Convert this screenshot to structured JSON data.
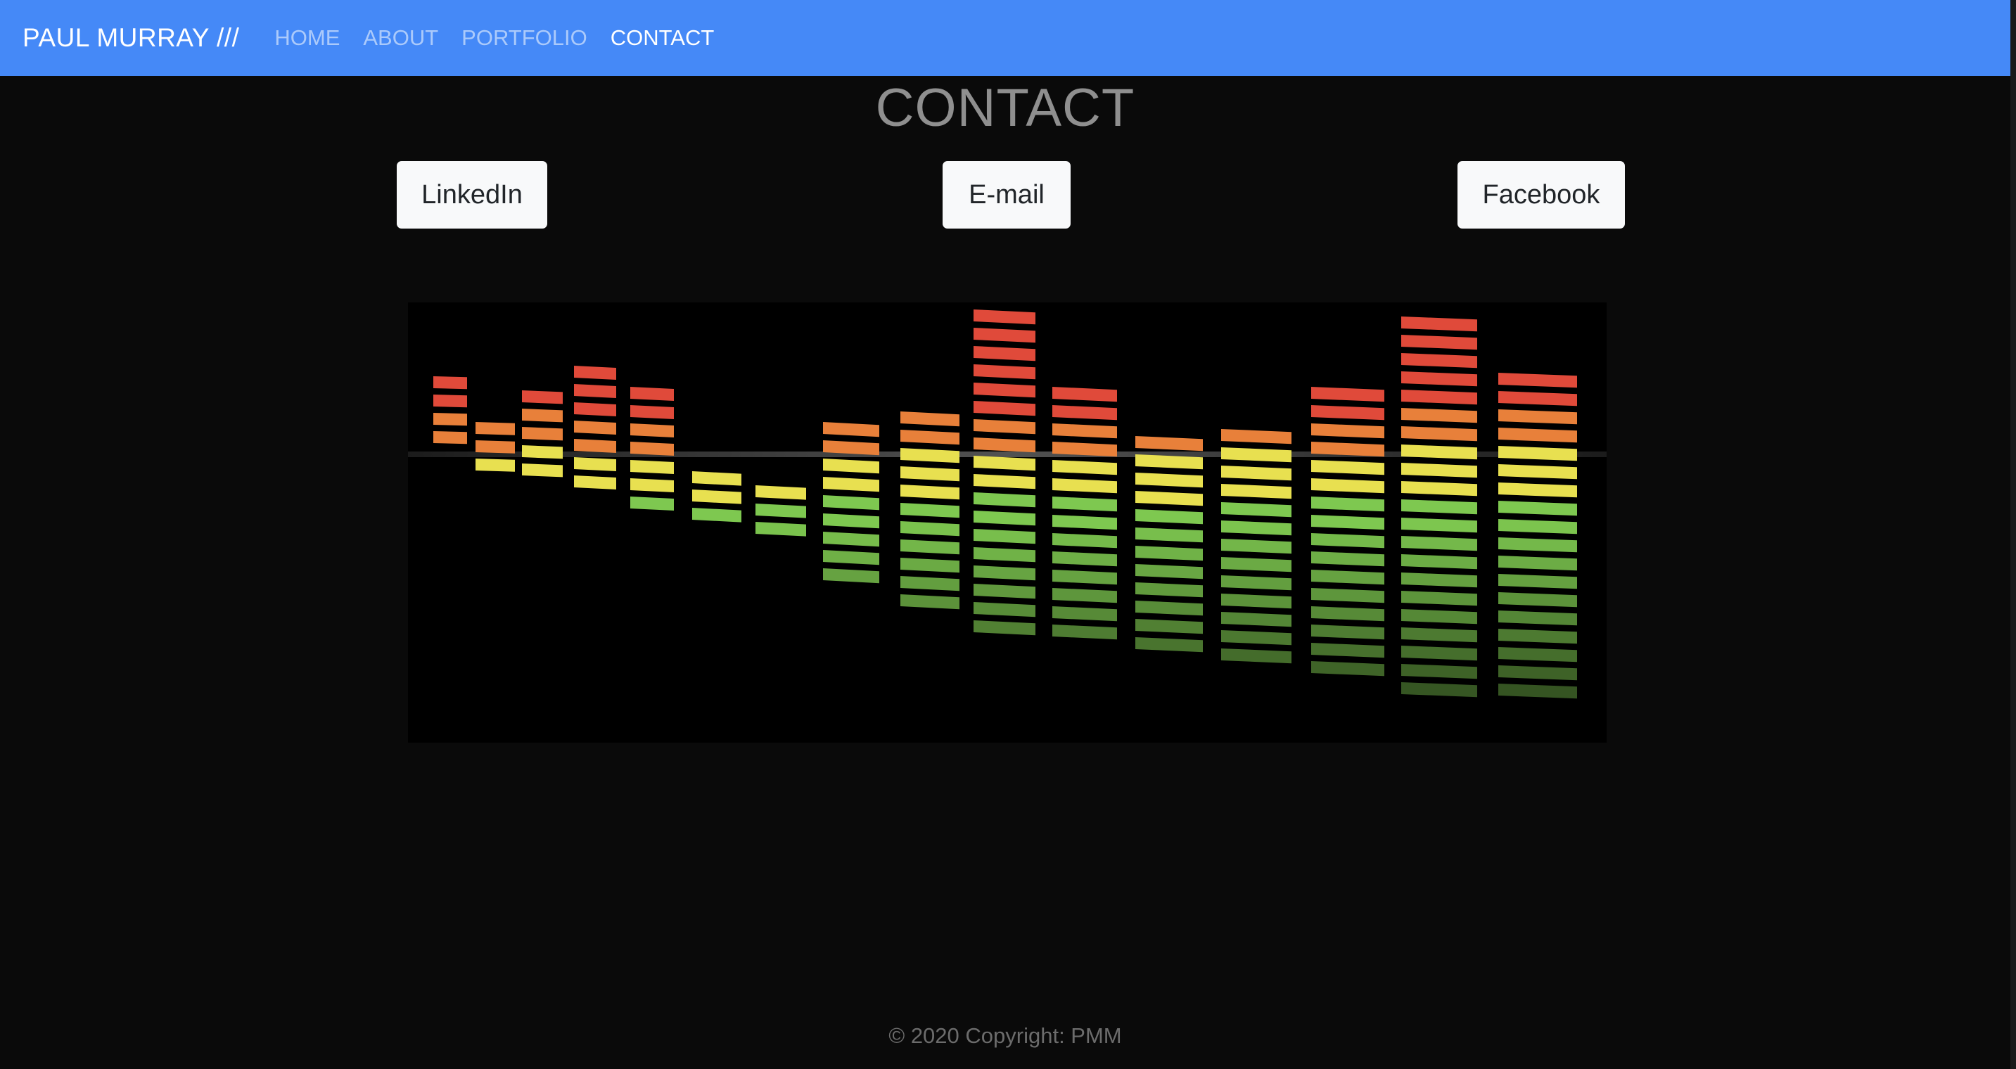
{
  "navbar": {
    "brand": "PAUL MURRAY ///",
    "links": [
      {
        "label": "HOME",
        "active": false
      },
      {
        "label": "ABOUT",
        "active": false
      },
      {
        "label": "PORTFOLIO",
        "active": false
      },
      {
        "label": "CONTACT",
        "active": true
      }
    ],
    "color": "#4589f7"
  },
  "main": {
    "title": "CONTACT",
    "buttons": {
      "linkedin": "LinkedIn",
      "email": "E-mail",
      "facebook": "Facebook"
    }
  },
  "footer": {
    "text": "© 2020 Copyright: PMM"
  },
  "image": {
    "subject": "audio-equalizer-bars",
    "colors": {
      "green": "#7ec850",
      "yellow": "#e8e050",
      "orange": "#e8803a",
      "red": "#e04a3a"
    }
  }
}
